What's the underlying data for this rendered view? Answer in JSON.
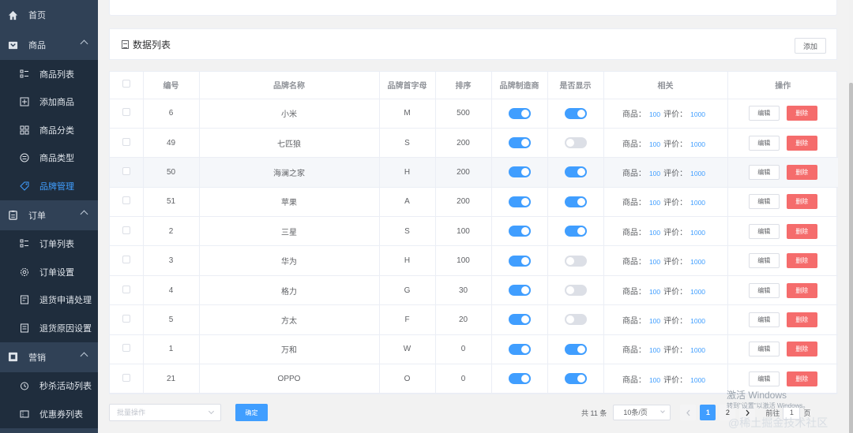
{
  "sidebar": {
    "home": "首页",
    "groups": [
      {
        "label": "商品",
        "items": [
          "商品列表",
          "添加商品",
          "商品分类",
          "商品类型",
          "品牌管理"
        ],
        "active": 4
      },
      {
        "label": "订单",
        "items": [
          "订单列表",
          "订单设置",
          "退货申请处理",
          "退货原因设置"
        ]
      },
      {
        "label": "营销",
        "items": [
          "秒杀活动列表",
          "优惠券列表"
        ]
      }
    ]
  },
  "list": {
    "title": "数据列表",
    "add_label": "添加"
  },
  "table": {
    "headers": [
      "编号",
      "品牌名称",
      "品牌首字母",
      "排序",
      "品牌制造商",
      "是否显示",
      "相关",
      "操作"
    ],
    "related_goods_label": "商品：",
    "related_comments_label": "评价：",
    "edit_label": "编辑",
    "delete_label": "删除",
    "rows": [
      {
        "id": "6",
        "name": "小米",
        "letter": "M",
        "sort": "500",
        "factory": true,
        "show": true,
        "goods": "100",
        "comments": "1000"
      },
      {
        "id": "49",
        "name": "七匹狼",
        "letter": "S",
        "sort": "200",
        "factory": true,
        "show": false,
        "goods": "100",
        "comments": "1000"
      },
      {
        "id": "50",
        "name": "海澜之家",
        "letter": "H",
        "sort": "200",
        "factory": true,
        "show": true,
        "goods": "100",
        "comments": "1000"
      },
      {
        "id": "51",
        "name": "苹果",
        "letter": "A",
        "sort": "200",
        "factory": true,
        "show": true,
        "goods": "100",
        "comments": "1000"
      },
      {
        "id": "2",
        "name": "三星",
        "letter": "S",
        "sort": "100",
        "factory": true,
        "show": true,
        "goods": "100",
        "comments": "1000"
      },
      {
        "id": "3",
        "name": "华为",
        "letter": "H",
        "sort": "100",
        "factory": true,
        "show": false,
        "goods": "100",
        "comments": "1000"
      },
      {
        "id": "4",
        "name": "格力",
        "letter": "G",
        "sort": "30",
        "factory": true,
        "show": false,
        "goods": "100",
        "comments": "1000"
      },
      {
        "id": "5",
        "name": "方太",
        "letter": "F",
        "sort": "20",
        "factory": true,
        "show": false,
        "goods": "100",
        "comments": "1000"
      },
      {
        "id": "1",
        "name": "万和",
        "letter": "W",
        "sort": "0",
        "factory": true,
        "show": true,
        "goods": "100",
        "comments": "1000"
      },
      {
        "id": "21",
        "name": "OPPO",
        "letter": "O",
        "sort": "0",
        "factory": true,
        "show": true,
        "goods": "100",
        "comments": "1000"
      }
    ]
  },
  "footer": {
    "batch_placeholder": "批量操作",
    "confirm_label": "确定",
    "total": "共 11 条",
    "page_size": "10条/页",
    "pages": [
      "1",
      "2"
    ],
    "current_page": "1",
    "goto_label": "前往",
    "goto_value": "1",
    "page_suffix": "页"
  },
  "overlay": {
    "activate_title": "激活 Windows",
    "activate_sub": "转到\"设置\"以激活 Windows。",
    "watermark": "@稀土掘金技术社区"
  },
  "colors": {
    "sidebar_bg": "#304156",
    "submenu_bg": "#1f2d3d",
    "primary": "#409eff",
    "danger": "#f56c6c",
    "switch_off": "#dcdfe6"
  }
}
